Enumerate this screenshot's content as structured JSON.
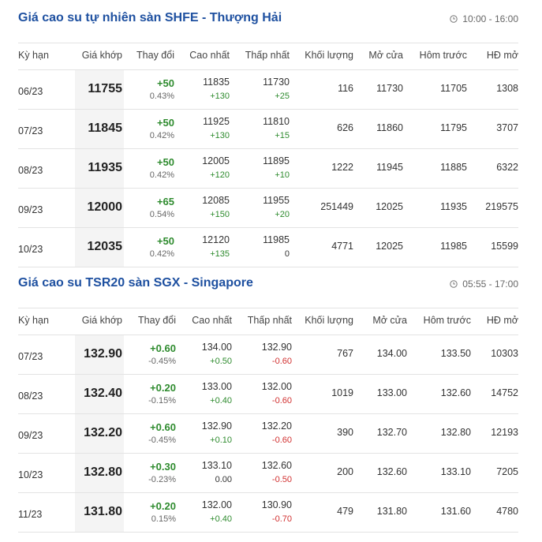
{
  "sections": [
    {
      "title": "Giá cao su tự nhiên sàn SHFE - Thượng Hải",
      "time": "10:00 - 16:00",
      "headers": [
        "Kỳ hạn",
        "Giá khớp",
        "Thay đổi",
        "Cao nhất",
        "Thấp nhất",
        "Khối lượng",
        "Mở cửa",
        "Hôm trước",
        "HĐ mở"
      ],
      "rows": [
        {
          "term": "06/23",
          "price": "11755",
          "change": "+50",
          "change_pct": "0.43%",
          "high": "11835",
          "high_chg": "+130",
          "low": "11730",
          "low_chg": "+25",
          "volume": "116",
          "open": "11730",
          "prev": "11705",
          "oi": "1308"
        },
        {
          "term": "07/23",
          "price": "11845",
          "change": "+50",
          "change_pct": "0.42%",
          "high": "11925",
          "high_chg": "+130",
          "low": "11810",
          "low_chg": "+15",
          "volume": "626",
          "open": "11860",
          "prev": "11795",
          "oi": "3707"
        },
        {
          "term": "08/23",
          "price": "11935",
          "change": "+50",
          "change_pct": "0.42%",
          "high": "12005",
          "high_chg": "+120",
          "low": "11895",
          "low_chg": "+10",
          "volume": "1222",
          "open": "11945",
          "prev": "11885",
          "oi": "6322"
        },
        {
          "term": "09/23",
          "price": "12000",
          "change": "+65",
          "change_pct": "0.54%",
          "high": "12085",
          "high_chg": "+150",
          "low": "11955",
          "low_chg": "+20",
          "volume": "251449",
          "open": "12025",
          "prev": "11935",
          "oi": "219575"
        },
        {
          "term": "10/23",
          "price": "12035",
          "change": "+50",
          "change_pct": "0.42%",
          "high": "12120",
          "high_chg": "+135",
          "low": "11985",
          "low_chg": "0",
          "volume": "4771",
          "open": "12025",
          "prev": "11985",
          "oi": "15599"
        }
      ]
    },
    {
      "title": "Giá cao su TSR20 sàn SGX - Singapore",
      "time": "05:55 - 17:00",
      "headers": [
        "Kỳ hạn",
        "Giá khớp",
        "Thay đổi",
        "Cao nhất",
        "Thấp nhất",
        "Khối lượng",
        "Mở cửa",
        "Hôm trước",
        "HĐ mở"
      ],
      "rows": [
        {
          "term": "07/23",
          "price": "132.90",
          "change": "+0.60",
          "change_pct": "-0.45%",
          "high": "134.00",
          "high_chg": "+0.50",
          "low": "132.90",
          "low_chg": "-0.60",
          "volume": "767",
          "open": "134.00",
          "prev": "133.50",
          "oi": "10303"
        },
        {
          "term": "08/23",
          "price": "132.40",
          "change": "+0.20",
          "change_pct": "-0.15%",
          "high": "133.00",
          "high_chg": "+0.40",
          "low": "132.00",
          "low_chg": "-0.60",
          "volume": "1019",
          "open": "133.00",
          "prev": "132.60",
          "oi": "14752"
        },
        {
          "term": "09/23",
          "price": "132.20",
          "change": "+0.60",
          "change_pct": "-0.45%",
          "high": "132.90",
          "high_chg": "+0.10",
          "low": "132.20",
          "low_chg": "-0.60",
          "volume": "390",
          "open": "132.70",
          "prev": "132.80",
          "oi": "12193"
        },
        {
          "term": "10/23",
          "price": "132.80",
          "change": "+0.30",
          "change_pct": "-0.23%",
          "high": "133.10",
          "high_chg": "0.00",
          "low": "132.60",
          "low_chg": "-0.50",
          "volume": "200",
          "open": "132.60",
          "prev": "133.10",
          "oi": "7205"
        },
        {
          "term": "11/23",
          "price": "131.80",
          "change": "+0.20",
          "change_pct": "0.15%",
          "high": "132.00",
          "high_chg": "+0.40",
          "low": "130.90",
          "low_chg": "-0.70",
          "volume": "479",
          "open": "131.80",
          "prev": "131.60",
          "oi": "4780"
        }
      ]
    }
  ],
  "colors": {
    "title": "#1e50a0",
    "up": "#2e8b2e",
    "down": "#d13030"
  },
  "icons": {
    "time": "clock-icon"
  }
}
